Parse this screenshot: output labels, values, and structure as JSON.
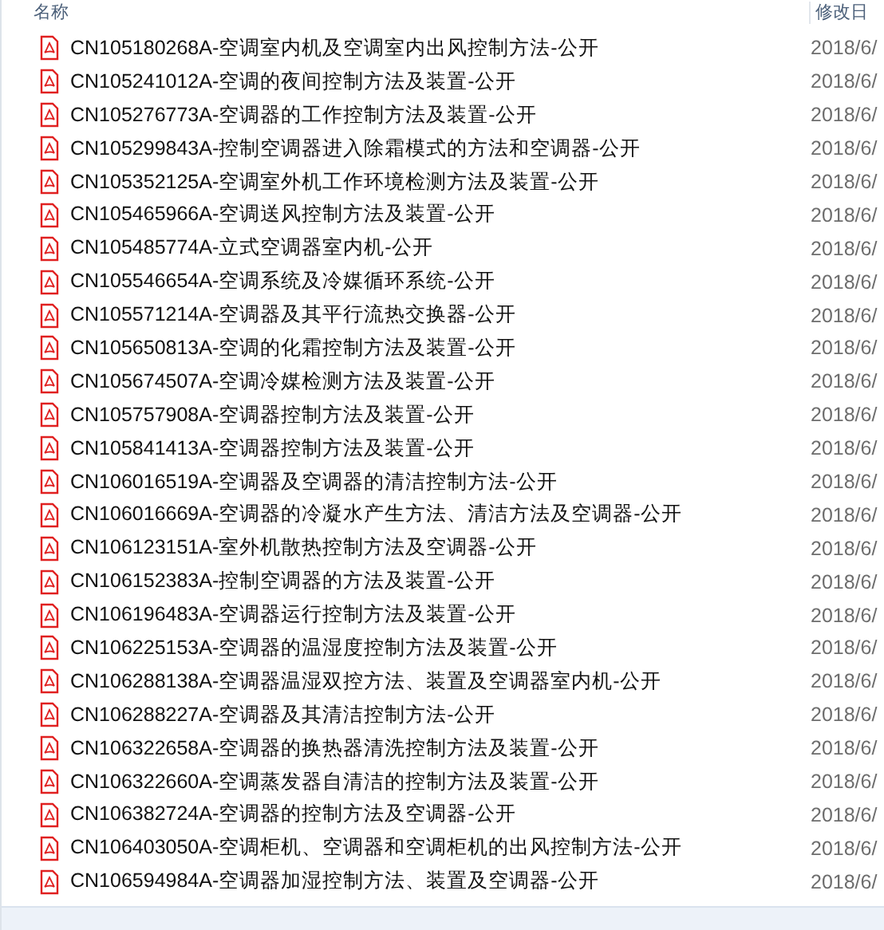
{
  "columns": [
    "名称",
    "修改日"
  ],
  "files": [
    {
      "name": "CN105180268A-空调室内机及空调室内出风控制方法-公开",
      "modified": "2018/6/"
    },
    {
      "name": "CN105241012A-空调的夜间控制方法及装置-公开",
      "modified": "2018/6/"
    },
    {
      "name": "CN105276773A-空调器的工作控制方法及装置-公开",
      "modified": "2018/6/"
    },
    {
      "name": "CN105299843A-控制空调器进入除霜模式的方法和空调器-公开",
      "modified": "2018/6/"
    },
    {
      "name": "CN105352125A-空调室外机工作环境检测方法及装置-公开",
      "modified": "2018/6/"
    },
    {
      "name": "CN105465966A-空调送风控制方法及装置-公开",
      "modified": "2018/6/"
    },
    {
      "name": "CN105485774A-立式空调器室内机-公开",
      "modified": "2018/6/"
    },
    {
      "name": "CN105546654A-空调系统及冷媒循环系统-公开",
      "modified": "2018/6/"
    },
    {
      "name": "CN105571214A-空调器及其平行流热交换器-公开",
      "modified": "2018/6/"
    },
    {
      "name": "CN105650813A-空调的化霜控制方法及装置-公开",
      "modified": "2018/6/"
    },
    {
      "name": "CN105674507A-空调冷媒检测方法及装置-公开",
      "modified": "2018/6/"
    },
    {
      "name": "CN105757908A-空调器控制方法及装置-公开",
      "modified": "2018/6/"
    },
    {
      "name": "CN105841413A-空调器控制方法及装置-公开",
      "modified": "2018/6/"
    },
    {
      "name": "CN106016519A-空调器及空调器的清洁控制方法-公开",
      "modified": "2018/6/"
    },
    {
      "name": "CN106016669A-空调器的冷凝水产生方法、清洁方法及空调器-公开",
      "modified": "2018/6/"
    },
    {
      "name": "CN106123151A-室外机散热控制方法及空调器-公开",
      "modified": "2018/6/"
    },
    {
      "name": "CN106152383A-控制空调器的方法及装置-公开",
      "modified": "2018/6/"
    },
    {
      "name": "CN106196483A-空调器运行控制方法及装置-公开",
      "modified": "2018/6/"
    },
    {
      "name": "CN106225153A-空调器的温湿度控制方法及装置-公开",
      "modified": "2018/6/"
    },
    {
      "name": "CN106288138A-空调器温湿双控方法、装置及空调器室内机-公开",
      "modified": "2018/6/"
    },
    {
      "name": "CN106288227A-空调器及其清洁控制方法-公开",
      "modified": "2018/6/"
    },
    {
      "name": "CN106322658A-空调器的换热器清洗控制方法及装置-公开",
      "modified": "2018/6/"
    },
    {
      "name": "CN106322660A-空调蒸发器自清洁的控制方法及装置-公开",
      "modified": "2018/6/"
    },
    {
      "name": "CN106382724A-空调器的控制方法及空调器-公开",
      "modified": "2018/6/"
    },
    {
      "name": "CN106403050A-空调柜机、空调器和空调柜机的出风控制方法-公开",
      "modified": "2018/6/"
    },
    {
      "name": "CN106594984A-空调器加湿控制方法、装置及空调器-公开",
      "modified": "2018/6/"
    }
  ]
}
